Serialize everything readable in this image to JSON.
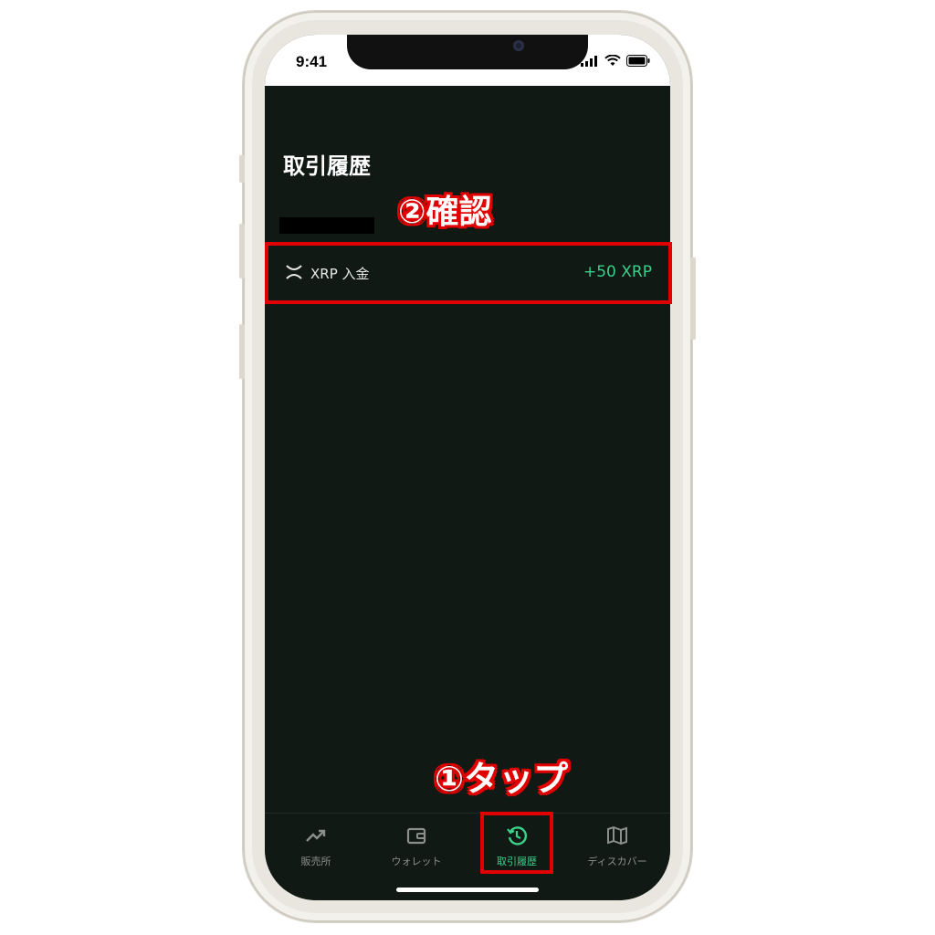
{
  "status_bar": {
    "time": "9:41"
  },
  "header": {
    "title": "取引履歴"
  },
  "transactions": [
    {
      "icon": "xrp-icon",
      "label": "XRP 入金",
      "amount": "+50 XRP"
    }
  ],
  "tab_bar": {
    "items": [
      {
        "label": "販売所",
        "icon": "trending-up-icon",
        "active": false
      },
      {
        "label": "ウォレット",
        "icon": "wallet-icon",
        "active": false
      },
      {
        "label": "取引履歴",
        "icon": "history-icon",
        "active": true
      },
      {
        "label": "ディスカバー",
        "icon": "map-icon",
        "active": false
      }
    ]
  },
  "annotations": {
    "step1": "①タップ",
    "step2": "②確認"
  },
  "colors": {
    "background": "#111915",
    "accent": "#3ad08a",
    "annotation": "#e00000"
  }
}
